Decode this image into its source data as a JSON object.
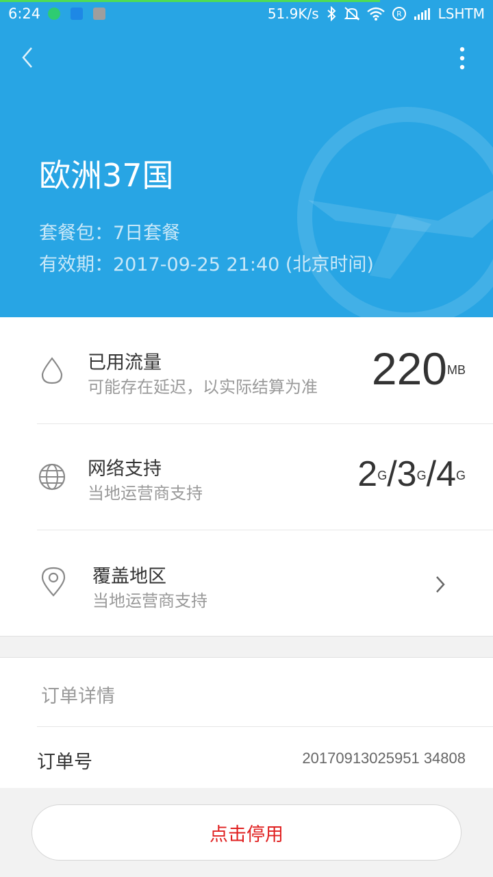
{
  "status_bar": {
    "time": "6:24",
    "speed": "51.9K/s",
    "carrier": "LSHTM",
    "icons": [
      "charging-icon",
      "app-notification-icon",
      "gallery-icon",
      "bluetooth-icon",
      "mute-icon",
      "wifi-icon",
      "registered-icon",
      "signal-icon"
    ]
  },
  "header": {
    "title": "欧洲37国",
    "package_line": "套餐包：7日套餐",
    "validity_line": "有效期：2017-09-25 21:40 (北京时间)",
    "accent_color": "#28a5e4"
  },
  "usage": {
    "title": "已用流量",
    "subtitle": "可能存在延迟，以实际结算为准",
    "value": "220",
    "unit": "MB"
  },
  "network": {
    "title": "网络支持",
    "subtitle": "当地运营商支持",
    "gen2": "2",
    "gen3": "3",
    "gen4": "4",
    "g": "G",
    "slash": "/"
  },
  "coverage": {
    "title": "覆盖地区",
    "subtitle": "当地运营商支持"
  },
  "order": {
    "section_title": "订单详情",
    "number_label": "订单号",
    "number_value": "20170913025951 34808"
  },
  "actions": {
    "stop_label": "点击停用",
    "stop_color": "#e02020"
  }
}
